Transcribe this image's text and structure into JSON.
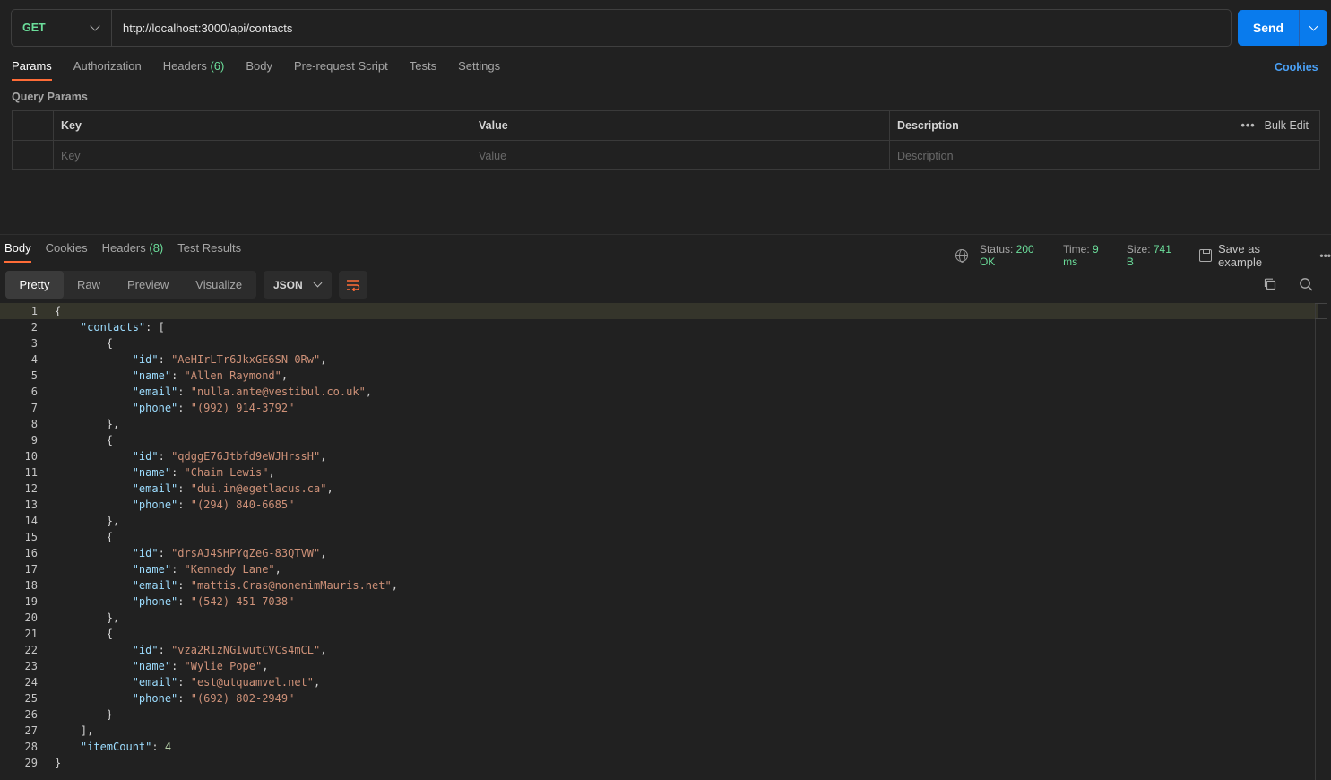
{
  "request": {
    "method": "GET",
    "url": "http://localhost:3000/api/contacts",
    "send_label": "Send"
  },
  "request_tabs": [
    {
      "label": "Params",
      "count": ""
    },
    {
      "label": "Authorization",
      "count": ""
    },
    {
      "label": "Headers",
      "count": "(6)"
    },
    {
      "label": "Body",
      "count": ""
    },
    {
      "label": "Pre-request Script",
      "count": ""
    },
    {
      "label": "Tests",
      "count": ""
    },
    {
      "label": "Settings",
      "count": ""
    }
  ],
  "cookies_link": "Cookies",
  "query_params": {
    "title": "Query Params",
    "headers": {
      "key": "Key",
      "value": "Value",
      "description": "Description",
      "bulk_edit": "Bulk Edit"
    },
    "placeholders": {
      "key": "Key",
      "value": "Value",
      "description": "Description"
    }
  },
  "response_tabs": [
    {
      "label": "Body",
      "count": ""
    },
    {
      "label": "Cookies",
      "count": ""
    },
    {
      "label": "Headers",
      "count": "(8)"
    },
    {
      "label": "Test Results",
      "count": ""
    }
  ],
  "response_status": {
    "status_label": "Status:",
    "status_value": "200 OK",
    "time_label": "Time:",
    "time_value": "9 ms",
    "size_label": "Size:",
    "size_value": "741 B",
    "save_example": "Save as example"
  },
  "view_modes": [
    "Pretty",
    "Raw",
    "Preview",
    "Visualize"
  ],
  "format": "JSON",
  "colors": {
    "accent": "#ff6c37",
    "send": "#097bed",
    "success": "#6bdd9a",
    "link": "#4aa0f5"
  },
  "code_lines": [
    [
      {
        "t": "p",
        "v": "{"
      }
    ],
    [
      {
        "t": "p",
        "v": "    "
      },
      {
        "t": "k",
        "v": "\"contacts\""
      },
      {
        "t": "p",
        "v": ": ["
      }
    ],
    [
      {
        "t": "p",
        "v": "        {"
      }
    ],
    [
      {
        "t": "p",
        "v": "            "
      },
      {
        "t": "k",
        "v": "\"id\""
      },
      {
        "t": "p",
        "v": ": "
      },
      {
        "t": "s",
        "v": "\"AeHIrLTr6JkxGE6SN-0Rw\""
      },
      {
        "t": "p",
        "v": ","
      }
    ],
    [
      {
        "t": "p",
        "v": "            "
      },
      {
        "t": "k",
        "v": "\"name\""
      },
      {
        "t": "p",
        "v": ": "
      },
      {
        "t": "s",
        "v": "\"Allen Raymond\""
      },
      {
        "t": "p",
        "v": ","
      }
    ],
    [
      {
        "t": "p",
        "v": "            "
      },
      {
        "t": "k",
        "v": "\"email\""
      },
      {
        "t": "p",
        "v": ": "
      },
      {
        "t": "s",
        "v": "\"nulla.ante@vestibul.co.uk\""
      },
      {
        "t": "p",
        "v": ","
      }
    ],
    [
      {
        "t": "p",
        "v": "            "
      },
      {
        "t": "k",
        "v": "\"phone\""
      },
      {
        "t": "p",
        "v": ": "
      },
      {
        "t": "s",
        "v": "\"(992) 914-3792\""
      }
    ],
    [
      {
        "t": "p",
        "v": "        },"
      }
    ],
    [
      {
        "t": "p",
        "v": "        {"
      }
    ],
    [
      {
        "t": "p",
        "v": "            "
      },
      {
        "t": "k",
        "v": "\"id\""
      },
      {
        "t": "p",
        "v": ": "
      },
      {
        "t": "s",
        "v": "\"qdggE76Jtbfd9eWJHrssH\""
      },
      {
        "t": "p",
        "v": ","
      }
    ],
    [
      {
        "t": "p",
        "v": "            "
      },
      {
        "t": "k",
        "v": "\"name\""
      },
      {
        "t": "p",
        "v": ": "
      },
      {
        "t": "s",
        "v": "\"Chaim Lewis\""
      },
      {
        "t": "p",
        "v": ","
      }
    ],
    [
      {
        "t": "p",
        "v": "            "
      },
      {
        "t": "k",
        "v": "\"email\""
      },
      {
        "t": "p",
        "v": ": "
      },
      {
        "t": "s",
        "v": "\"dui.in@egetlacus.ca\""
      },
      {
        "t": "p",
        "v": ","
      }
    ],
    [
      {
        "t": "p",
        "v": "            "
      },
      {
        "t": "k",
        "v": "\"phone\""
      },
      {
        "t": "p",
        "v": ": "
      },
      {
        "t": "s",
        "v": "\"(294) 840-6685\""
      }
    ],
    [
      {
        "t": "p",
        "v": "        },"
      }
    ],
    [
      {
        "t": "p",
        "v": "        {"
      }
    ],
    [
      {
        "t": "p",
        "v": "            "
      },
      {
        "t": "k",
        "v": "\"id\""
      },
      {
        "t": "p",
        "v": ": "
      },
      {
        "t": "s",
        "v": "\"drsAJ4SHPYqZeG-83QTVW\""
      },
      {
        "t": "p",
        "v": ","
      }
    ],
    [
      {
        "t": "p",
        "v": "            "
      },
      {
        "t": "k",
        "v": "\"name\""
      },
      {
        "t": "p",
        "v": ": "
      },
      {
        "t": "s",
        "v": "\"Kennedy Lane\""
      },
      {
        "t": "p",
        "v": ","
      }
    ],
    [
      {
        "t": "p",
        "v": "            "
      },
      {
        "t": "k",
        "v": "\"email\""
      },
      {
        "t": "p",
        "v": ": "
      },
      {
        "t": "s",
        "v": "\"mattis.Cras@nonenimMauris.net\""
      },
      {
        "t": "p",
        "v": ","
      }
    ],
    [
      {
        "t": "p",
        "v": "            "
      },
      {
        "t": "k",
        "v": "\"phone\""
      },
      {
        "t": "p",
        "v": ": "
      },
      {
        "t": "s",
        "v": "\"(542) 451-7038\""
      }
    ],
    [
      {
        "t": "p",
        "v": "        },"
      }
    ],
    [
      {
        "t": "p",
        "v": "        {"
      }
    ],
    [
      {
        "t": "p",
        "v": "            "
      },
      {
        "t": "k",
        "v": "\"id\""
      },
      {
        "t": "p",
        "v": ": "
      },
      {
        "t": "s",
        "v": "\"vza2RIzNGIwutCVCs4mCL\""
      },
      {
        "t": "p",
        "v": ","
      }
    ],
    [
      {
        "t": "p",
        "v": "            "
      },
      {
        "t": "k",
        "v": "\"name\""
      },
      {
        "t": "p",
        "v": ": "
      },
      {
        "t": "s",
        "v": "\"Wylie Pope\""
      },
      {
        "t": "p",
        "v": ","
      }
    ],
    [
      {
        "t": "p",
        "v": "            "
      },
      {
        "t": "k",
        "v": "\"email\""
      },
      {
        "t": "p",
        "v": ": "
      },
      {
        "t": "s",
        "v": "\"est@utquamvel.net\""
      },
      {
        "t": "p",
        "v": ","
      }
    ],
    [
      {
        "t": "p",
        "v": "            "
      },
      {
        "t": "k",
        "v": "\"phone\""
      },
      {
        "t": "p",
        "v": ": "
      },
      {
        "t": "s",
        "v": "\"(692) 802-2949\""
      }
    ],
    [
      {
        "t": "p",
        "v": "        }"
      }
    ],
    [
      {
        "t": "p",
        "v": "    ],"
      }
    ],
    [
      {
        "t": "p",
        "v": "    "
      },
      {
        "t": "k",
        "v": "\"itemCount\""
      },
      {
        "t": "p",
        "v": ": "
      },
      {
        "t": "n",
        "v": "4"
      }
    ],
    [
      {
        "t": "p",
        "v": "}"
      }
    ]
  ]
}
